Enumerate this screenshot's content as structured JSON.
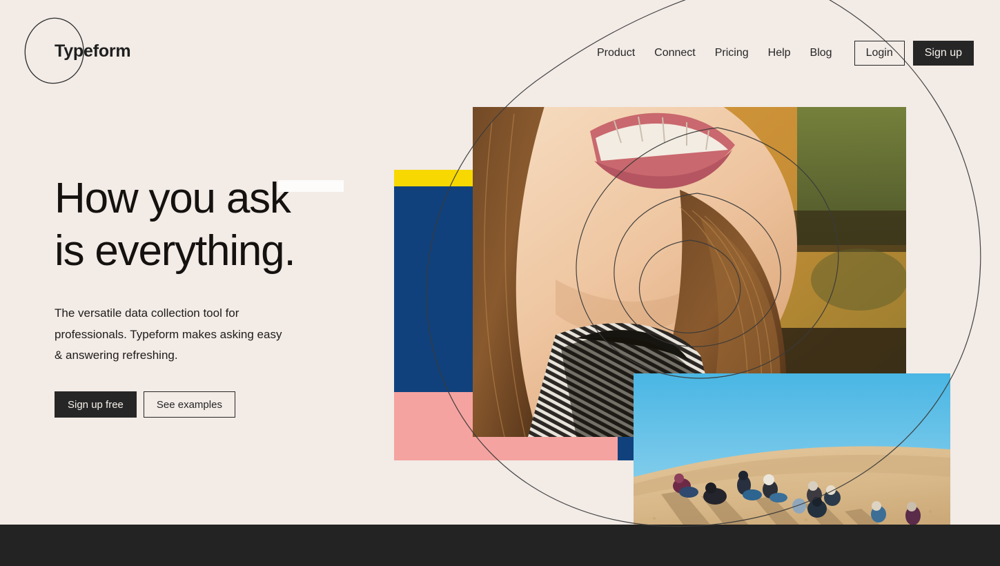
{
  "brand": {
    "name": "Typeform",
    "mark_icon": "hand-drawn-circle-icon"
  },
  "nav": {
    "links": [
      {
        "label": "Product"
      },
      {
        "label": "Connect"
      },
      {
        "label": "Pricing"
      },
      {
        "label": "Help"
      },
      {
        "label": "Blog"
      }
    ],
    "login_label": "Login",
    "signup_label": "Sign up"
  },
  "hero": {
    "headline": "How you ask\nis everything.",
    "subcopy": "The versatile data collection tool for professionals. Typeform makes asking easy & answering refreshing.",
    "primary_cta": "Sign up free",
    "secondary_cta": "See examples"
  },
  "colors": {
    "background": "#f2ebe6",
    "ink": "#262626",
    "footer": "#232323",
    "yellow": "#f7d800",
    "navy": "#10417c",
    "pink": "#f5a3a0",
    "sky": "#6ec2e8",
    "white_tab": "#fdfcfb"
  },
  "imagery": {
    "portrait_alt": "Smiling woman in striped top, warm amber background",
    "desert_alt": "Group of people sitting on a sand dune under a blue sky"
  }
}
